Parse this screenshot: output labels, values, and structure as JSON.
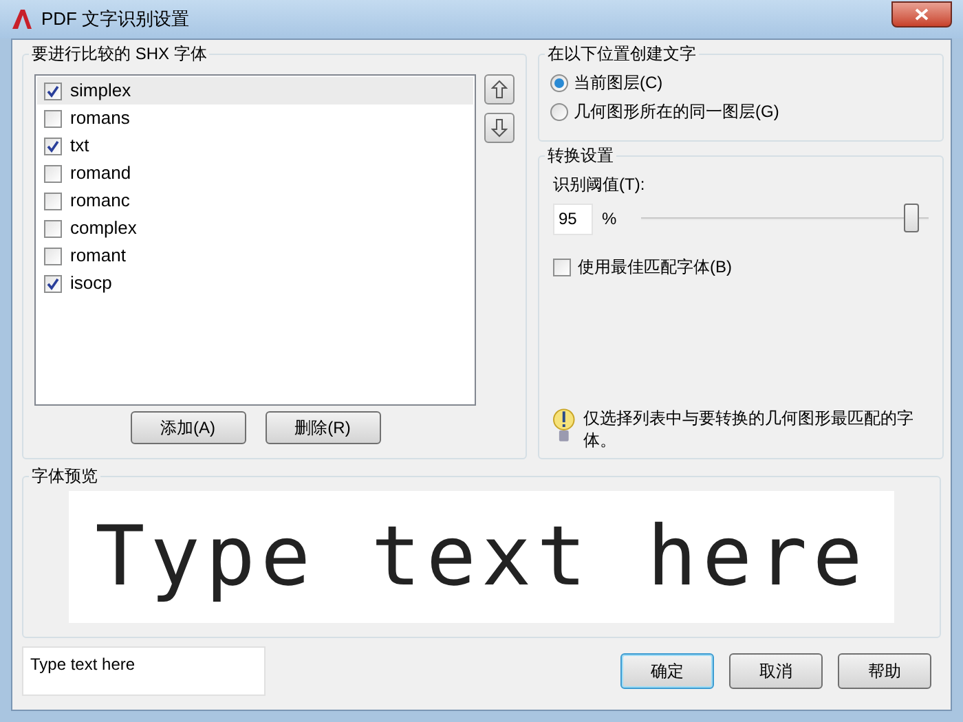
{
  "window": {
    "title": "PDF 文字识别设置"
  },
  "fonts_group": {
    "title": "要进行比较的 SHX 字体",
    "items": [
      {
        "label": "simplex",
        "checked": true,
        "selected": true
      },
      {
        "label": "romans",
        "checked": false,
        "selected": false
      },
      {
        "label": "txt",
        "checked": true,
        "selected": false
      },
      {
        "label": "romand",
        "checked": false,
        "selected": false
      },
      {
        "label": "romanc",
        "checked": false,
        "selected": false
      },
      {
        "label": "complex",
        "checked": false,
        "selected": false
      },
      {
        "label": "romant",
        "checked": false,
        "selected": false
      },
      {
        "label": "isocp",
        "checked": true,
        "selected": false
      }
    ],
    "buttons": [
      "添加(A)",
      "删除(R)"
    ]
  },
  "location_group": {
    "title": "在以下位置创建文字",
    "options": [
      {
        "label": "当前图层(C)",
        "selected": true
      },
      {
        "label": "几何图形所在的同一图层(G)",
        "selected": false
      }
    ]
  },
  "conversion_group": {
    "title": "转换设置",
    "threshold_label": "识别阈值(T):",
    "threshold_value": "95",
    "unit": "%",
    "threshold": {
      "level": 0.95
    },
    "best_match": {
      "label": "使用最佳匹配字体(B)",
      "checked": false
    },
    "tip": "仅选择列表中与要转换的几何图形最匹配的字体。"
  },
  "preview_group": {
    "title": "字体预览",
    "preview_text": "Type text here"
  },
  "sample_field": {
    "value": "Type text here"
  },
  "buttons": [
    {
      "label": "确定",
      "default": true
    },
    {
      "label": "取消",
      "default": false
    },
    {
      "label": "帮助",
      "default": false
    }
  ]
}
